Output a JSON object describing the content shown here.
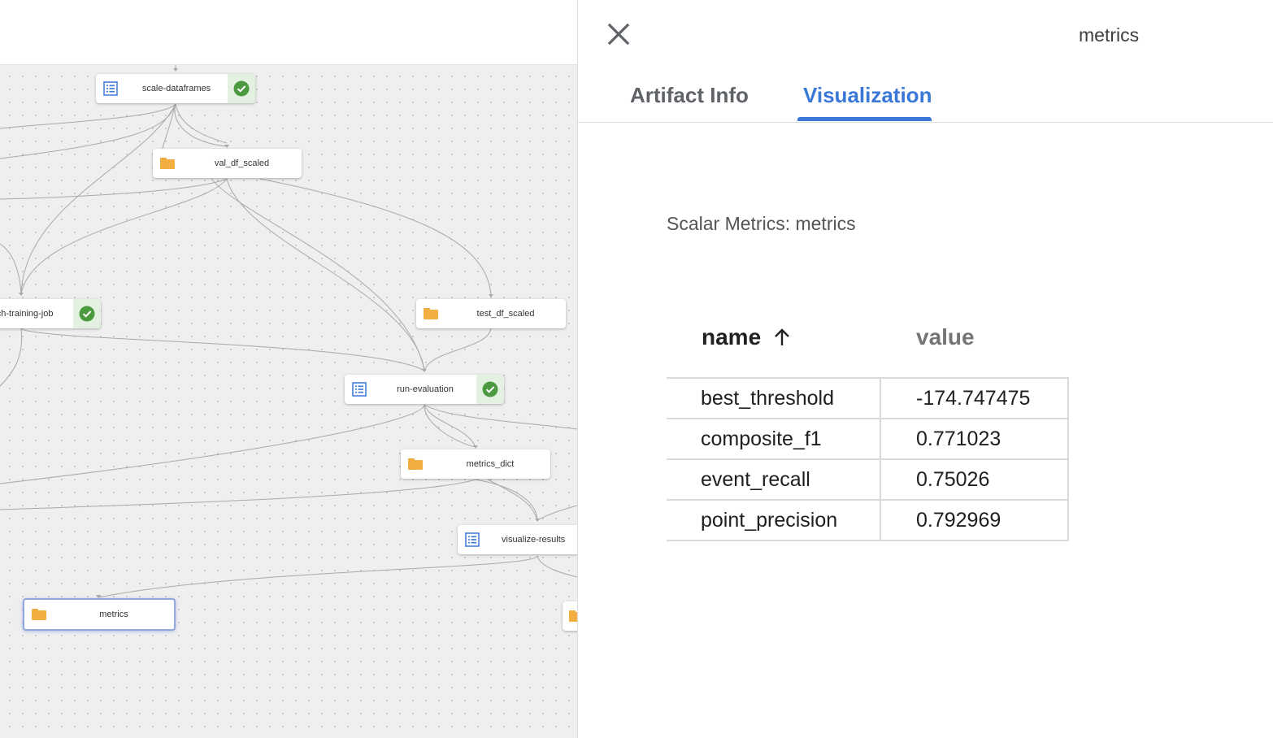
{
  "graph": {
    "nodes": [
      {
        "id": "scale-dataframes",
        "label": "scale-dataframes",
        "kind": "execution",
        "status": "succeeded"
      },
      {
        "id": "val_df_scaled",
        "label": "val_df_scaled",
        "kind": "artifact"
      },
      {
        "id": "training-job",
        "label": "orch-training-job",
        "kind": "execution",
        "status": "succeeded"
      },
      {
        "id": "test_df_scaled",
        "label": "test_df_scaled",
        "kind": "artifact"
      },
      {
        "id": "run-evaluation",
        "label": "run-evaluation",
        "kind": "execution",
        "status": "succeeded"
      },
      {
        "id": "metrics_dict",
        "label": "metrics_dict",
        "kind": "artifact"
      },
      {
        "id": "visualize-results",
        "label": "visualize-results",
        "kind": "execution"
      },
      {
        "id": "metrics",
        "label": "metrics",
        "kind": "artifact",
        "selected": true
      }
    ]
  },
  "panel": {
    "title": "metrics",
    "tabs": [
      {
        "label": "Artifact Info",
        "active": false
      },
      {
        "label": "Visualization",
        "active": true
      }
    ],
    "heading": "Scalar Metrics: metrics",
    "table": {
      "columns": [
        "name",
        "value"
      ],
      "sort": {
        "column": "name",
        "direction": "ascending"
      },
      "rows": [
        {
          "name": "best_threshold",
          "value": "-174.747475"
        },
        {
          "name": "composite_f1",
          "value": "0.771023"
        },
        {
          "name": "event_recall",
          "value": "0.75026"
        },
        {
          "name": "point_precision",
          "value": "0.792969"
        }
      ]
    }
  },
  "colors": {
    "accent": "#3a78d8",
    "success": "#4c9a3f",
    "folder": "#f2ae40",
    "execution_icon": "#3a78d8"
  },
  "icons": {
    "close": "close-icon",
    "sort": "arrow-up-icon",
    "artifact": "folder-icon",
    "execution": "list-icon",
    "status": "check-circle-icon"
  }
}
